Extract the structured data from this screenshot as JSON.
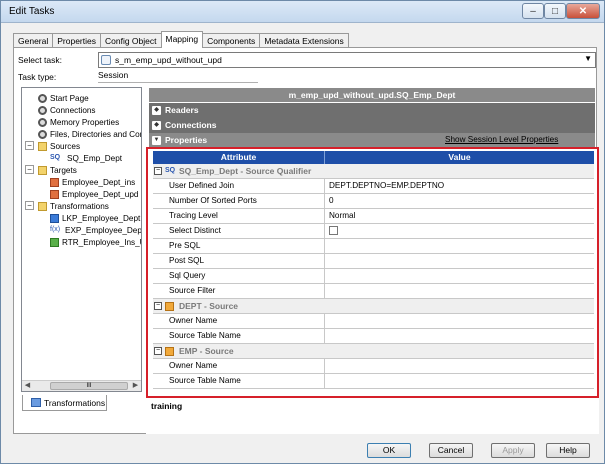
{
  "window": {
    "title": "Edit Tasks"
  },
  "tabs": [
    "General",
    "Properties",
    "Config Object",
    "Mapping",
    "Components",
    "Metadata Extensions"
  ],
  "active_tab": "Mapping",
  "select_task": {
    "label": "Select task:",
    "value": "s_m_emp_upd_without_upd"
  },
  "task_type": {
    "label": "Task type:",
    "value": "Session"
  },
  "tree": {
    "items": [
      {
        "label": "Start Page"
      },
      {
        "label": "Connections"
      },
      {
        "label": "Memory Properties"
      },
      {
        "label": "Files, Directories and Com"
      }
    ],
    "sources": {
      "label": "Sources",
      "items": [
        "SQ_Emp_Dept"
      ]
    },
    "targets": {
      "label": "Targets",
      "items": [
        "Employee_Dept_ins",
        "Employee_Dept_upd"
      ]
    },
    "transformations": {
      "label": "Transformations",
      "items": [
        "LKP_Employee_Dept",
        "EXP_Employee_Dept",
        "RTR_Employee_Ins_U"
      ]
    },
    "scroll_thumb": "III"
  },
  "bottom_tab": "Transformations",
  "mapping": {
    "header": "m_emp_upd_without_upd.SQ_Emp_Dept",
    "sections": [
      "Readers",
      "Connections",
      "Properties"
    ],
    "show_session_link": "Show Session Level Properties"
  },
  "grid": {
    "col_attribute": "Attribute",
    "col_value": "Value",
    "groups": [
      {
        "title": "SQ_Emp_Dept - Source Qualifier",
        "icon": "SQ",
        "rows": [
          {
            "attr": "User Defined Join",
            "value": "DEPT.DEPTNO=EMP.DEPTNO"
          },
          {
            "attr": "Number Of Sorted Ports",
            "value": "0"
          },
          {
            "attr": "Tracing Level",
            "value": "Normal"
          },
          {
            "attr": "Select Distinct",
            "value": ""
          },
          {
            "attr": "Pre SQL",
            "value": ""
          },
          {
            "attr": "Post SQL",
            "value": ""
          },
          {
            "attr": "Sql Query",
            "value": ""
          },
          {
            "attr": "Source Filter",
            "value": ""
          }
        ]
      },
      {
        "title": "DEPT - Source",
        "rows": [
          {
            "attr": "Owner Name",
            "value": ""
          },
          {
            "attr": "Source Table Name",
            "value": ""
          }
        ]
      },
      {
        "title": "EMP - Source",
        "rows": [
          {
            "attr": "Owner Name",
            "value": ""
          },
          {
            "attr": "Source Table Name",
            "value": ""
          }
        ]
      }
    ]
  },
  "description": "training",
  "buttons": {
    "ok": "OK",
    "cancel": "Cancel",
    "apply": "Apply",
    "help": "Help"
  }
}
